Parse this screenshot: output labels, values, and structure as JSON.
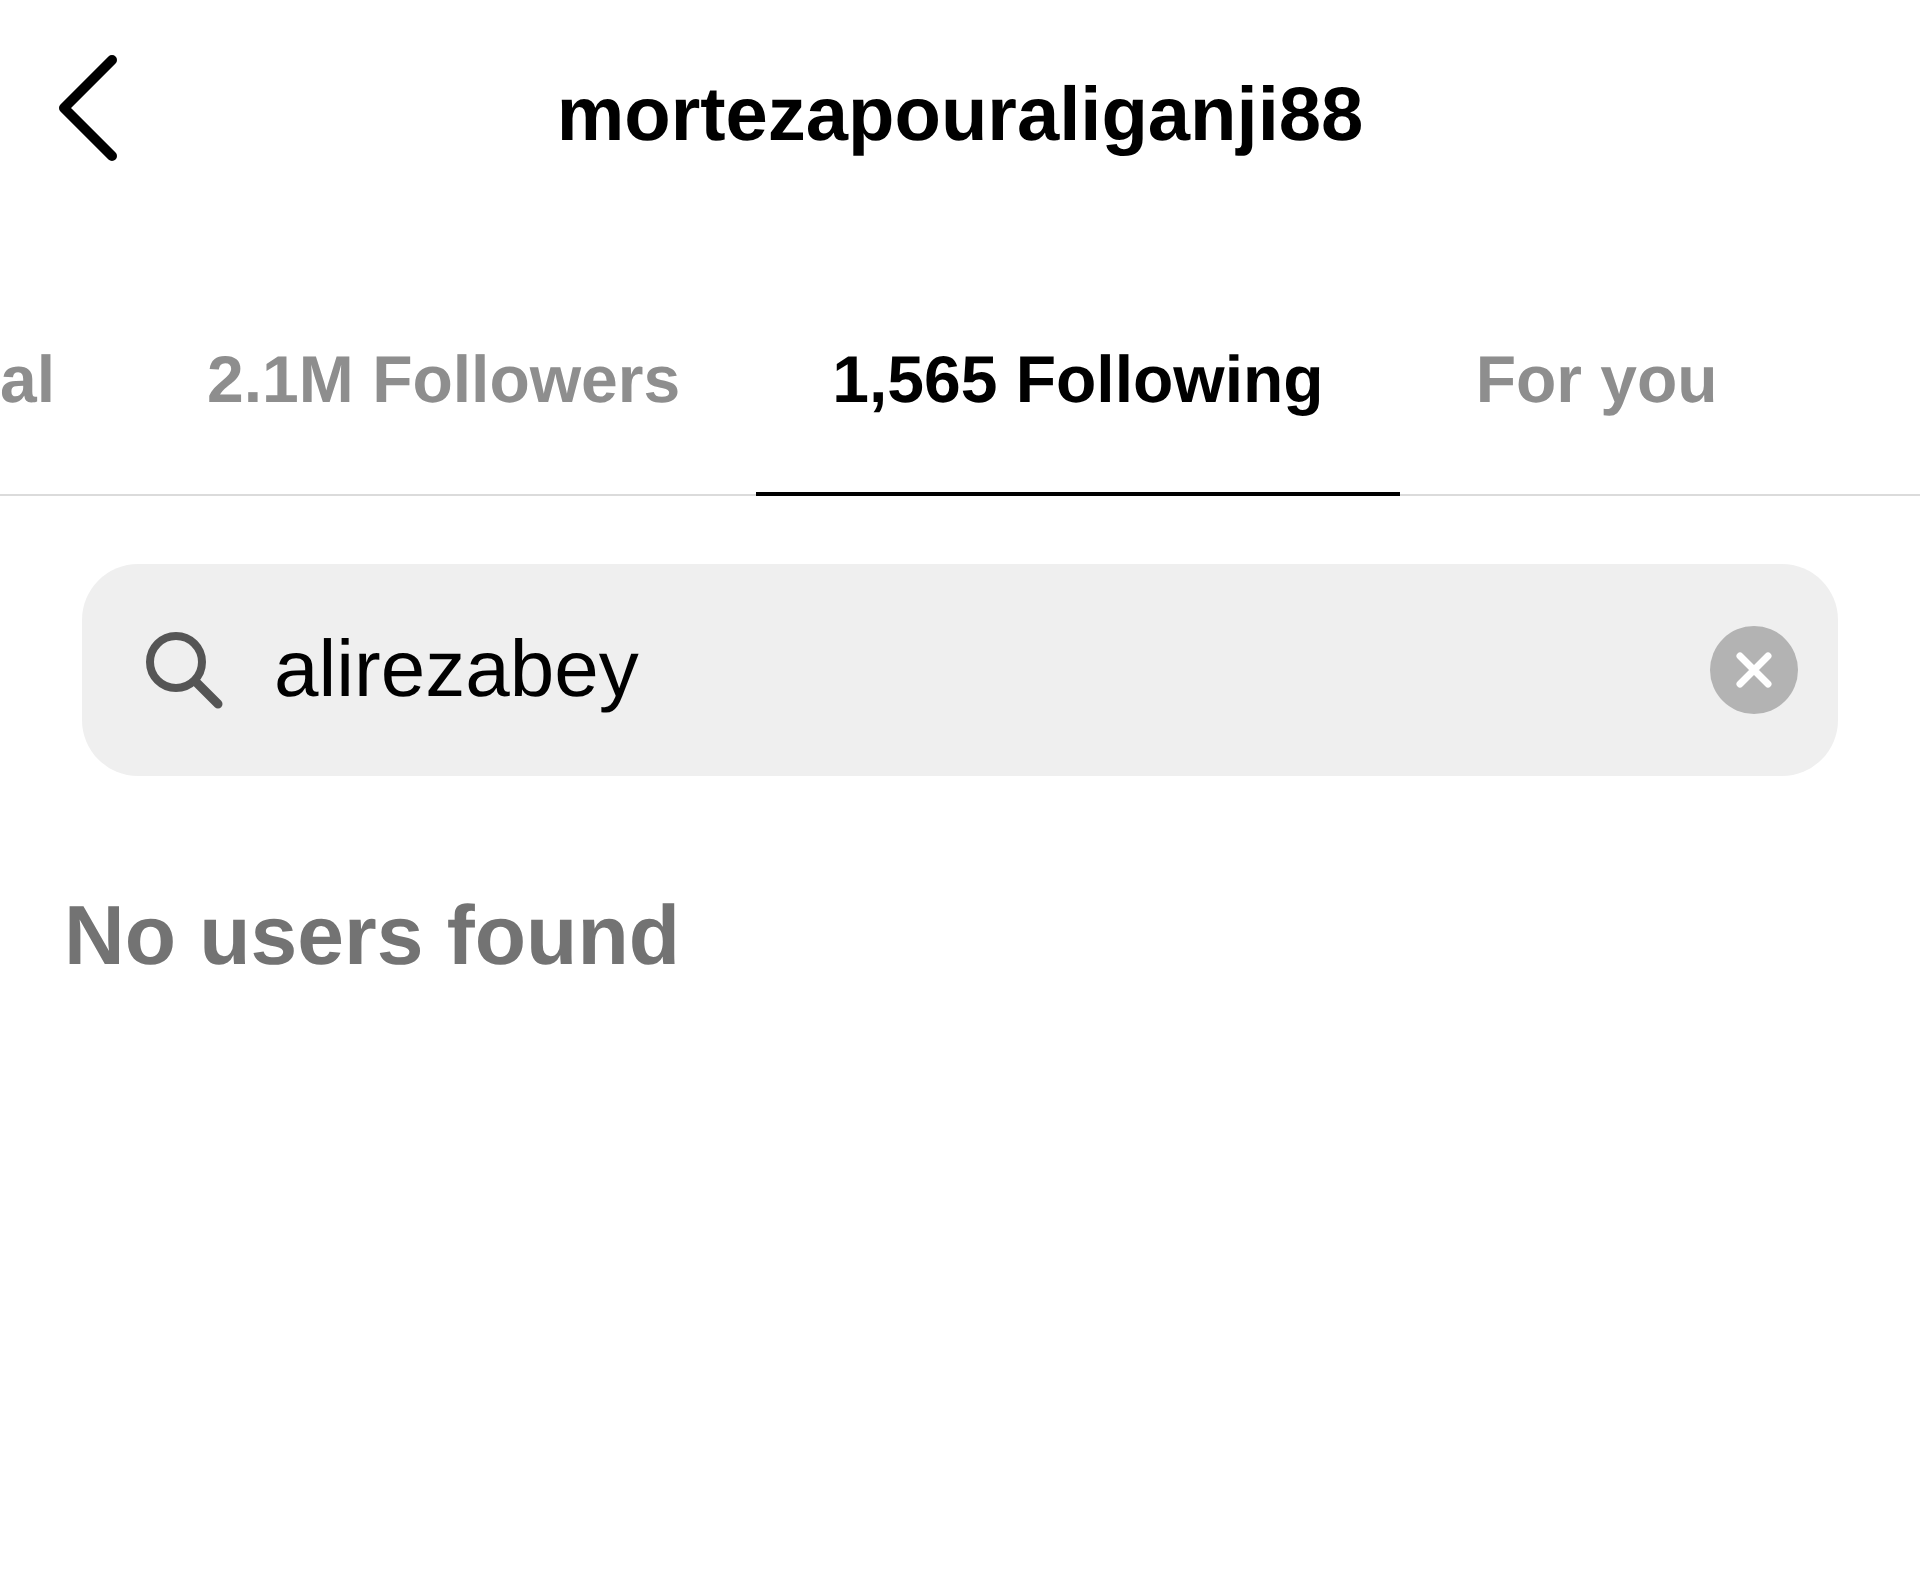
{
  "header": {
    "title": "mortezapouraliganji88"
  },
  "tabs": [
    {
      "label": "al",
      "selected": false
    },
    {
      "label": "2.1M Followers",
      "selected": false
    },
    {
      "label": "1,565 Following",
      "selected": true
    },
    {
      "label": "For you",
      "selected": false
    }
  ],
  "search": {
    "value": "alirezabey"
  },
  "message": "No users found"
}
